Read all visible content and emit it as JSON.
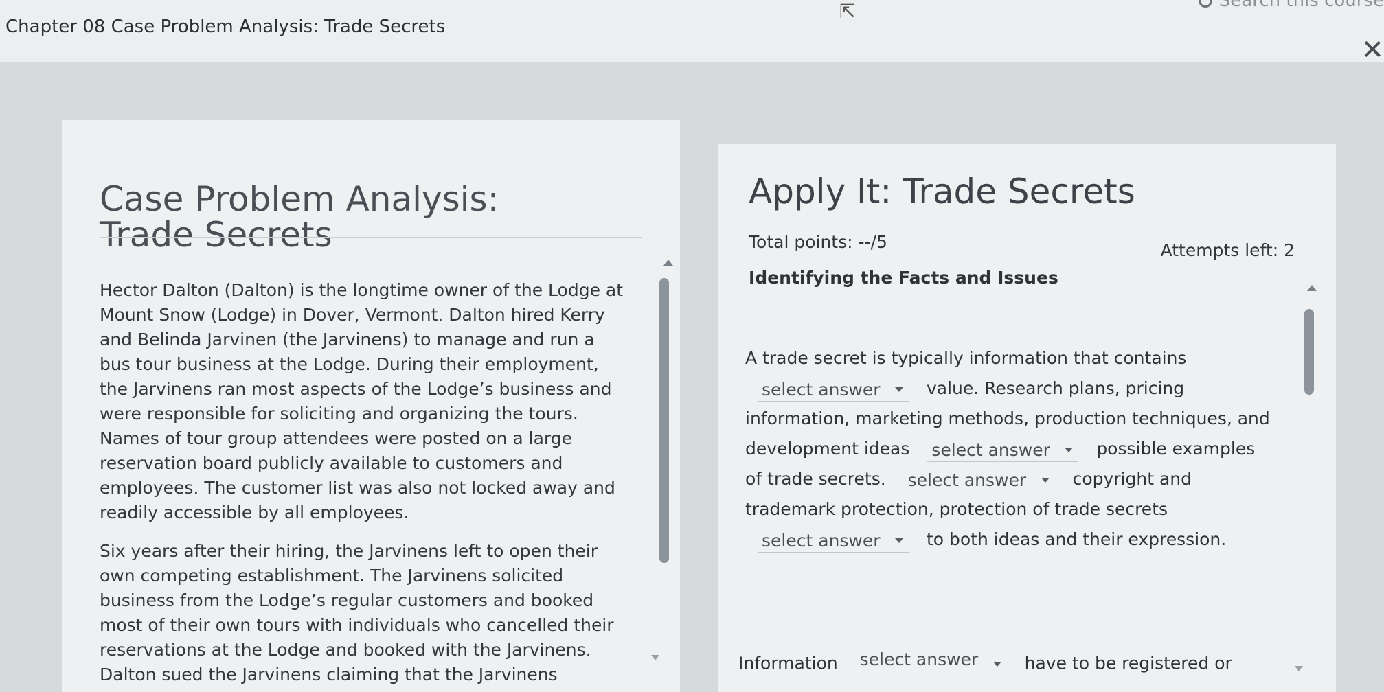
{
  "header": {
    "chapter_title": "Chapter 08 Case Problem Analysis: Trade Secrets",
    "search_label": "Search this course",
    "close_label": "✕"
  },
  "left_panel": {
    "title": "Case Problem Analysis: Trade Secrets",
    "paragraphs": [
      "Hector Dalton (Dalton) is the longtime owner of the Lodge at Mount Snow (Lodge) in Dover, Vermont. Dalton hired Kerry and Belinda Jarvinen (the Jarvinens) to manage and run a bus tour business at the Lodge. During their employment, the Jarvinens ran most aspects of the Lodge’s business and were responsible for soliciting and organizing the tours. Names of tour group attendees were posted on a large reservation board publicly available to customers and employees. The customer list was also not locked away and readily accessible by all employees.",
      "Six years after their hiring, the Jarvinens left to open their own competing establishment. The Jarvinens solicited business from the Lodge’s regular customers and booked most of their own tours with individuals who cancelled their reservations at the Lodge and booked with the Jarvinens. Dalton sued the Jarvinens claiming that the Jarvinens violated trade secret law"
    ]
  },
  "right_panel": {
    "title": "Apply It: Trade Secrets",
    "total_points": "Total points: --/5",
    "attempts_left": "Attempts left: 2",
    "section_heading": "Identifying the Facts and Issues",
    "select_placeholder": "select answer",
    "q1_part1": "A trade secret is typically information that contains",
    "q1_part2": "value. Research plans, pricing",
    "q1_part3": "information, marketing methods, production techniques, and",
    "q1_part4": "development ideas",
    "q1_part5": "possible examples",
    "q1_part6": "of trade secrets.",
    "q1_part7": "copyright and",
    "q1_part8": "trademark protection, protection of trade secrets",
    "q1_part9": "to both ideas and their expression.",
    "q2_part1": "Information",
    "q2_part2": "have to be registered or"
  }
}
